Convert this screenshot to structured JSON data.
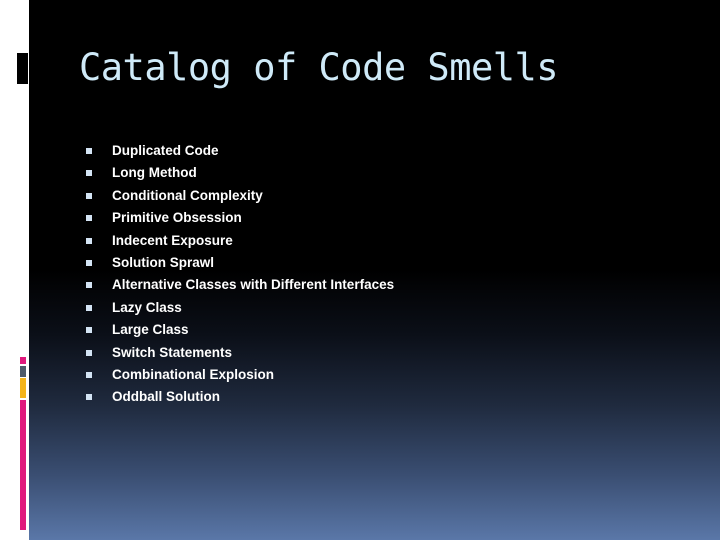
{
  "slide": {
    "title": "Catalog of Code Smells",
    "bullet_icon": "square-bullet-icon",
    "items": [
      "Duplicated Code",
      "Long Method",
      "Conditional Complexity",
      "Primitive Obsession",
      "Indecent Exposure",
      "Solution Sprawl",
      "Alternative Classes with Different Interfaces",
      "Lazy Class",
      "Large Class",
      "Switch Statements",
      "Combinational Explosion",
      "Oddball Solution"
    ]
  },
  "theme": {
    "title_color": "#cfeaf8",
    "text_color": "#ffffff",
    "accent_pink": "#e0197d",
    "accent_gray": "#4e5a6a",
    "accent_yellow": "#f4b41a",
    "gradient_bottom": "#5a77a8"
  }
}
